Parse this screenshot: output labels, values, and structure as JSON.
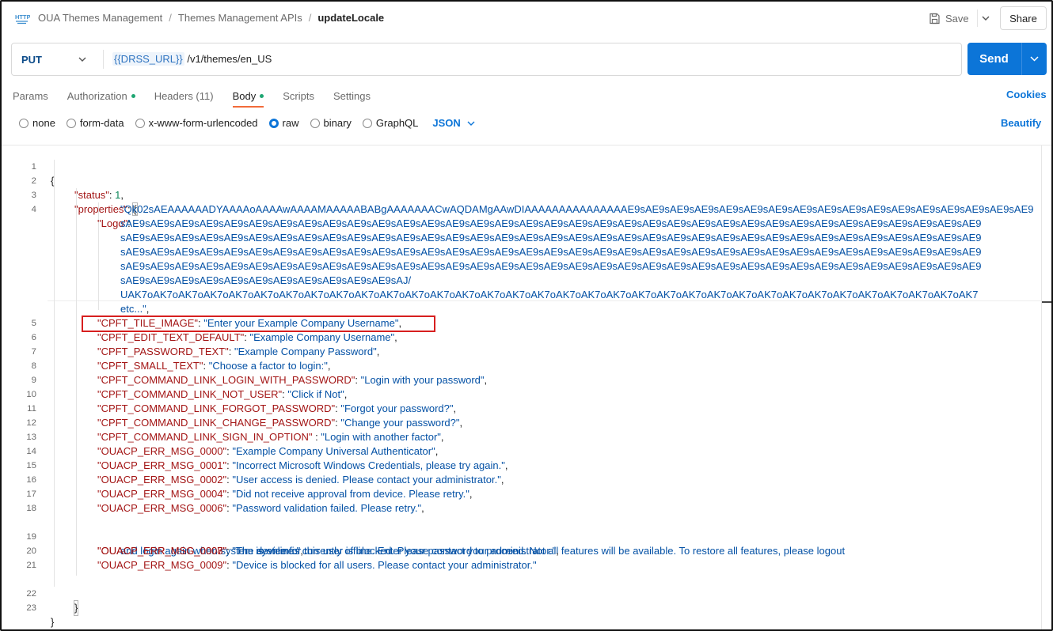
{
  "breadcrumb": {
    "collection": "OUA Themes Management",
    "folder": "Themes Management APIs",
    "request": "updateLocale",
    "separator": "/"
  },
  "header": {
    "save_label": "Save",
    "share_label": "Share"
  },
  "request": {
    "method": "PUT",
    "url_variable": "{{DRSS_URL}}",
    "url_path": " /v1/themes/en_US",
    "send_label": "Send"
  },
  "tabs": [
    {
      "label": "Params"
    },
    {
      "label": "Authorization"
    },
    {
      "label": "Headers (11)"
    },
    {
      "label": "Body"
    },
    {
      "label": "Scripts"
    },
    {
      "label": "Settings"
    }
  ],
  "cookies_label": "Cookies",
  "body_types": [
    {
      "label": "none"
    },
    {
      "label": "form-data"
    },
    {
      "label": "x-www-form-urlencoded"
    },
    {
      "label": "raw"
    },
    {
      "label": "binary"
    },
    {
      "label": "GraphQL"
    }
  ],
  "body_format": "JSON",
  "beautify_label": "Beautify",
  "editor": {
    "line_numbers": [
      "1",
      "2",
      "3",
      "4",
      "5",
      "6",
      "7",
      "8",
      "9",
      "10",
      "11",
      "12",
      "13",
      "14",
      "15",
      "16",
      "17",
      "18",
      "19",
      "20",
      "21",
      "22",
      "23"
    ],
    "open_brace": "{",
    "close_brace": "}",
    "status_key": "\"status\"",
    "status_value": "1",
    "properties_key": "\"properties\"",
    "logo_key": "\"Logo\"",
    "logo_lines": [
      "\"Qk02sAEAAAAAADYAAAAoAAAAwAAAAMAAAAABABgAAAAAAACwAQDAMgAAwDIAAAAAAAAAAAAAAAE9sAE9sAE9sAE9sAE9sAE9sAE9sAE9sAE9sAE9sAE9sAE9sAE9sAE9sAE9sAE9sAE9",
      "sAE9sAE9sAE9sAE9sAE9sAE9sAE9sAE9sAE9sAE9sAE9sAE9sAE9sAE9sAE9sAE9sAE9sAE9sAE9sAE9sAE9sAE9sAE9sAE9sAE9sAE9sAE9sAE9sAE9sAE9sAE9sAE9sAE9sAE9sAE9",
      "sAE9sAE9sAE9sAE9sAE9sAE9sAE9sAE9sAE9sAE9sAE9sAE9sAE9sAE9sAE9sAE9sAE9sAE9sAE9sAE9sAE9sAE9sAE9sAE9sAE9sAE9sAE9sAE9sAE9sAE9sAE9sAE9sAE9sAE9sAE9",
      "sAE9sAE9sAE9sAE9sAE9sAE9sAE9sAE9sAE9sAE9sAE9sAE9sAE9sAE9sAE9sAE9sAE9sAE9sAE9sAE9sAE9sAE9sAE9sAE9sAE9sAE9sAE9sAE9sAE9sAE9sAE9sAE9sAE9sAE9sAE9",
      "sAE9sAE9sAE9sAE9sAE9sAE9sAE9sAE9sAE9sAE9sAE9sAE9sAE9sAE9sAE9sAE9sAE9sAE9sAE9sAE9sAE9sAE9sAE9sAE9sAE9sAE9sAE9sAE9sAE9sAE9sAE9sAE9sAE9sAE9sAE9",
      "sAE9sAE9sAE9sAE9sAE9sAE9sAE9sAE9sAE9sAE9sAE9sAJ/",
      "UAK7oAK7oAK7oAK7oAK7oAK7oAK7oAK7oAK7oAK7oAK7oAK7oAK7oAK7oAK7oAK7oAK7oAK7oAK7oAK7oAK7oAK7oAK7oAK7oAK7oAK7oAK7oAK7oAK7oAK7oAK7oAK7oAK7oAK7"
    ],
    "logo_last": "etc...\"",
    "entries": [
      {
        "key": "\"CPFT_TILE_IMAGE\"",
        "sep": ": ",
        "value": "\"Enter your Example Company Username\"",
        "tail": ","
      },
      {
        "key": "\"CPFT_EDIT_TEXT_DEFAULT\"",
        "sep": ": ",
        "value": "\"Example Company Username\"",
        "tail": ","
      },
      {
        "key": "\"CPFT_PASSWORD_TEXT\"",
        "sep": ": ",
        "value": "\"Example Company Password\"",
        "tail": ","
      },
      {
        "key": "\"CPFT_SMALL_TEXT\"",
        "sep": ": ",
        "value": "\"Choose a factor to login:\"",
        "tail": ","
      },
      {
        "key": "\"CPFT_COMMAND_LINK_LOGIN_WITH_PASSWORD\"",
        "sep": ": ",
        "value": "\"Login with your password\"",
        "tail": ","
      },
      {
        "key": "\"CPFT_COMMAND_LINK_NOT_USER\"",
        "sep": ": ",
        "value": "\"Click if Not\"",
        "tail": ","
      },
      {
        "key": "\"CPFT_COMMAND_LINK_FORGOT_PASSWORD\"",
        "sep": ": ",
        "value": "\"Forgot your password?\"",
        "tail": ","
      },
      {
        "key": "\"CPFT_COMMAND_LINK_CHANGE_PASSWORD\"",
        "sep": ": ",
        "value": "\"Change your password?\"",
        "tail": ","
      },
      {
        "key": "\"CPFT_COMMAND_LINK_SIGN_IN_OPTION\"",
        "sep": " : ",
        "value": "\"Login with another factor\"",
        "tail": ","
      },
      {
        "key": "\"OUACP_ERR_MSG_0000\"",
        "sep": ": ",
        "value": "\"Example Company Universal Authenticator\"",
        "tail": ","
      },
      {
        "key": "\"OUACP_ERR_MSG_0001\"",
        "sep": ": ",
        "value": "\"Incorrect Microsoft Windows Credentials, please try again.\"",
        "tail": ","
      },
      {
        "key": "\"OUACP_ERR_MSG_0002\"",
        "sep": ": ",
        "value": "\"User access is denied. Please contact your administrator.\"",
        "tail": ","
      },
      {
        "key": "\"OUACP_ERR_MSG_0004\"",
        "sep": ": ",
        "value": "\"Did not receive approval from device. Please retry.\"",
        "tail": ","
      },
      {
        "key": "\"OUACP_ERR_MSG_0006\"",
        "sep": ": ",
        "value": "\"Password validation failed. Please retry.\"",
        "tail": ","
      }
    ],
    "msg_0007_key": "\"OUACP_ERR_MSG_0007\"",
    "msg_0007_line1": "\"The system is currently offline. Enter your password to proceed. Not all features will be available. To restore all features, please logout",
    "msg_0007_line2": "and login again when system is online.\"",
    "entries_end": [
      {
        "key": "\"OUACP_ERR_MSG_0008\"",
        "sep": ": ",
        "value": "\"The device for this user is blocked. Please contact your administrator.\"",
        "tail": ","
      },
      {
        "key": "\"OUACP_ERR_MSG_0009\"",
        "sep": ": ",
        "value": "\"Device is blocked for all users. Please contact your administrator.\"",
        "tail": ""
      }
    ]
  },
  "colors": {
    "accent": "#0c75d8",
    "json_key": "#a31515",
    "json_string": "#0451a5",
    "json_number": "#098658",
    "highlight_box": "#d71f1f",
    "active_tab_underline": "#f26b3a",
    "status_dot": "#1ea672"
  }
}
